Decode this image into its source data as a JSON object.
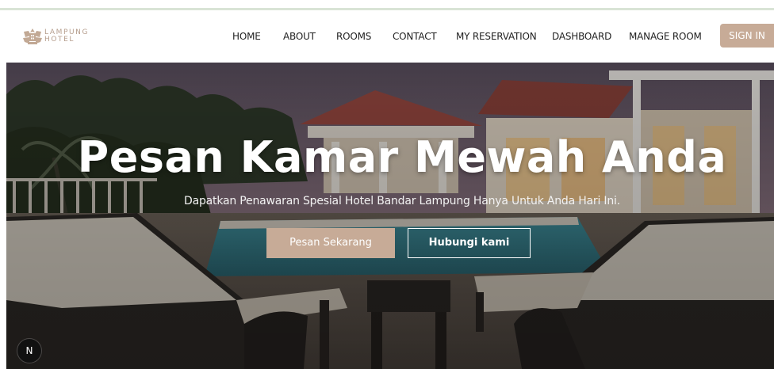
{
  "brand": {
    "name_line1": "LAMPUNG",
    "name_line2": "HOTEL",
    "color": "#b59d8c",
    "logo_icon": "hotel-crest-icon"
  },
  "nav": {
    "items": [
      {
        "label": "HOME"
      },
      {
        "label": "ABOUT"
      },
      {
        "label": "ROOMS"
      },
      {
        "label": "CONTACT"
      },
      {
        "label": "MY RESERVATION"
      },
      {
        "label": "DASHBOARD"
      },
      {
        "label": "MANAGE ROOM"
      }
    ],
    "signin_label": "SIGN IN"
  },
  "hero": {
    "title": "Pesan Kamar Mewah Anda",
    "subtitle": "Dapatkan Penawaran Spesial Hotel Bandar Lampung Hanya Untuk Anda Hari Ini.",
    "primary_button": "Pesan Sekarang",
    "secondary_button": "Hubungi kami"
  },
  "dev_badge": {
    "label": "N"
  },
  "colors": {
    "accent": "#c7ab97",
    "nav_text": "#222222",
    "top_line": "#d9e4d6"
  }
}
